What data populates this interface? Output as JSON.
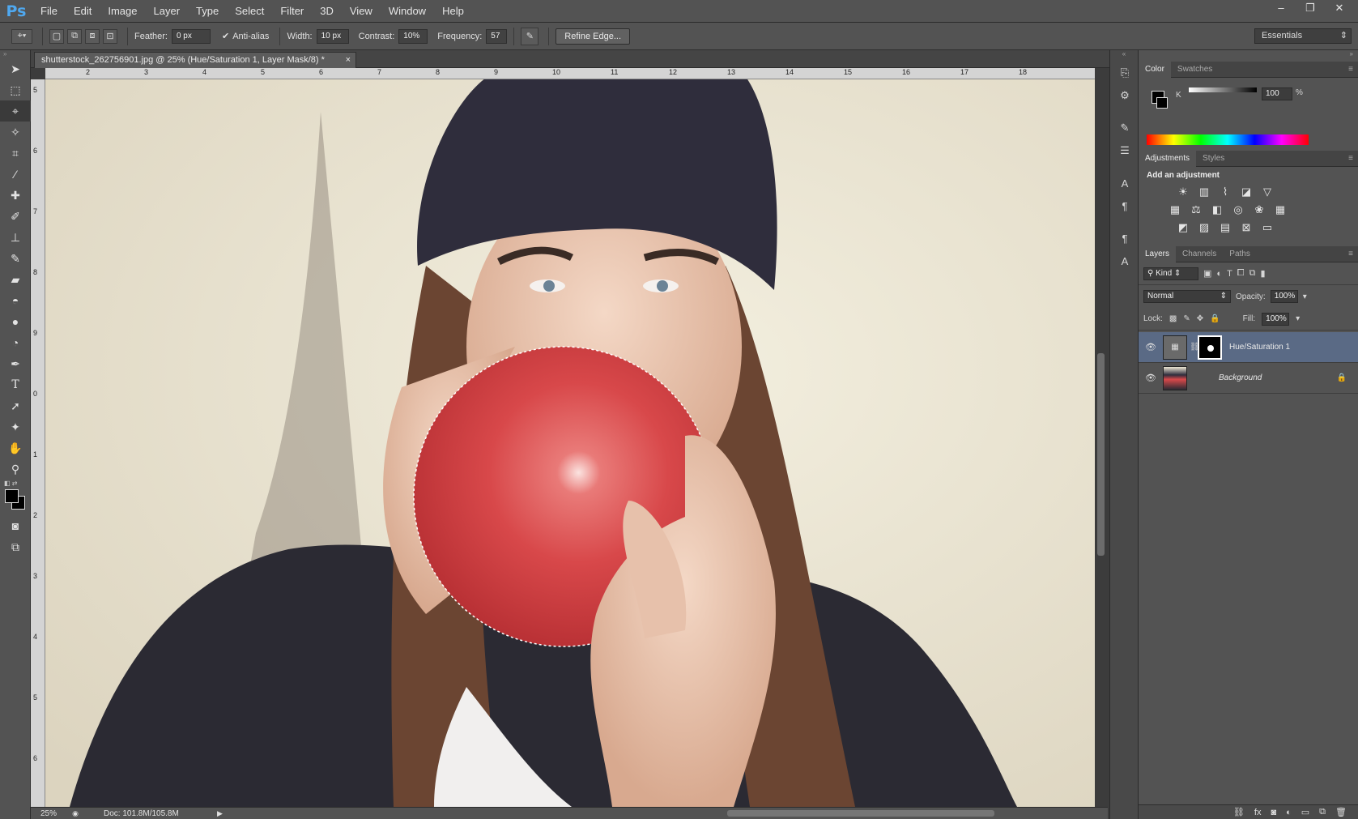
{
  "app": {
    "logo": "Ps"
  },
  "menu": [
    "File",
    "Edit",
    "Image",
    "Layer",
    "Type",
    "Select",
    "Filter",
    "3D",
    "View",
    "Window",
    "Help"
  ],
  "window_controls": {
    "minimize": "–",
    "restore": "❐",
    "close": "✕"
  },
  "options": {
    "feather_label": "Feather:",
    "feather_value": "0 px",
    "antialias_label": "Anti-alias",
    "width_label": "Width:",
    "width_value": "10 px",
    "contrast_label": "Contrast:",
    "contrast_value": "10%",
    "frequency_label": "Frequency:",
    "frequency_value": "57",
    "refine_edge": "Refine Edge...",
    "workspace": "Essentials"
  },
  "document": {
    "tab_title": "shutterstock_262756901.jpg @ 25% (Hue/Saturation 1, Layer Mask/8) *",
    "close": "×",
    "ruler_top": [
      "2",
      "3",
      "4",
      "5",
      "6",
      "7",
      "8",
      "9",
      "10",
      "11",
      "12",
      "13",
      "14",
      "15",
      "16",
      "17",
      "18"
    ],
    "ruler_left": [
      "5",
      "6",
      "7",
      "8",
      "9",
      "0",
      "1",
      "2",
      "3",
      "4",
      "5",
      "6"
    ]
  },
  "status": {
    "zoom": "25%",
    "doc": "Doc: 101.8M/105.8M"
  },
  "color_panel": {
    "tabs": [
      "Color",
      "Swatches"
    ],
    "channel": "K",
    "value": "100",
    "unit": "%"
  },
  "adjustments_panel": {
    "tabs": [
      "Adjustments",
      "Styles"
    ],
    "heading": "Add an adjustment"
  },
  "layers_panel": {
    "tabs": [
      "Layers",
      "Channels",
      "Paths"
    ],
    "filter": "Kind",
    "blend_mode": "Normal",
    "opacity_label": "Opacity:",
    "opacity_value": "100%",
    "lock_label": "Lock:",
    "fill_label": "Fill:",
    "fill_value": "100%",
    "layers": [
      {
        "name": "Hue/Saturation 1",
        "selected": true
      },
      {
        "name": "Background",
        "selected": false
      }
    ]
  },
  "colors": {
    "accent": "#4fa8ef",
    "selected_layer": "#5a6a85",
    "balloon": "#d8484a"
  }
}
